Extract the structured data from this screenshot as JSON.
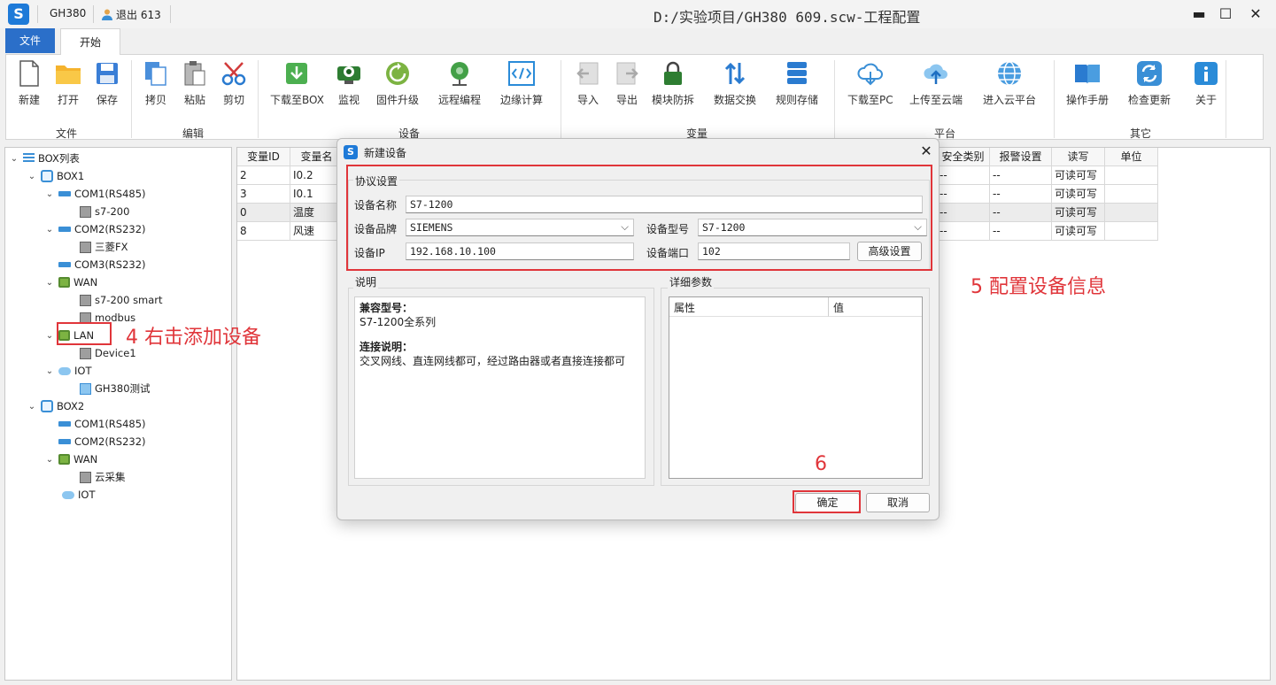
{
  "titlebar": {
    "app_name": "GH380",
    "user_text": "退出 613",
    "window_title": "D:/实验项目/GH380 609.scw-工程配置"
  },
  "tabs": {
    "file": "文件",
    "home": "开始"
  },
  "ribbon": {
    "groups": [
      "文件",
      "编辑",
      "设备",
      "变量",
      "平台",
      "其它"
    ],
    "buttons": [
      "新建",
      "打开",
      "保存",
      "拷贝",
      "粘贴",
      "剪切",
      "下载至BOX",
      "监视",
      "固件升级",
      "远程编程",
      "边缘计算",
      "导入",
      "导出",
      "模块防拆",
      "数据交换",
      "规则存储",
      "下载至PC",
      "上传至云端",
      "进入云平台",
      "操作手册",
      "检查更新",
      "关于"
    ]
  },
  "tree": [
    {
      "label": "BOX列表"
    },
    {
      "label": "BOX1"
    },
    {
      "label": "COM1(RS485)"
    },
    {
      "label": "s7-200"
    },
    {
      "label": "COM2(RS232)"
    },
    {
      "label": "三菱FX"
    },
    {
      "label": "COM3(RS232)"
    },
    {
      "label": "WAN"
    },
    {
      "label": "s7-200 smart"
    },
    {
      "label": "modbus"
    },
    {
      "label": "LAN"
    },
    {
      "label": "Device1"
    },
    {
      "label": "IOT"
    },
    {
      "label": "GH380测试"
    },
    {
      "label": "BOX2"
    },
    {
      "label": "COM1(RS485)"
    },
    {
      "label": "COM2(RS232)"
    },
    {
      "label": "WAN"
    },
    {
      "label": "云采集"
    },
    {
      "label": "IOT"
    }
  ],
  "grid": {
    "left_headers": [
      "变量ID",
      "变量名"
    ],
    "right_headers": [
      "安全类别",
      "报警设置",
      "读写",
      "单位"
    ],
    "rows": [
      {
        "id": "2",
        "name": "I0.2",
        "safety": "--",
        "alarm": "--",
        "rw": "可读可写",
        "unit": ""
      },
      {
        "id": "3",
        "name": "I0.1",
        "safety": "--",
        "alarm": "--",
        "rw": "可读可写",
        "unit": ""
      },
      {
        "id": "0",
        "name": "温度",
        "safety": "--",
        "alarm": "--",
        "rw": "可读可写",
        "unit": ""
      },
      {
        "id": "8",
        "name": "风速",
        "safety": "--",
        "alarm": "--",
        "rw": "可读可写",
        "unit": ""
      }
    ]
  },
  "dialog": {
    "title": "新建设备",
    "protocol_group": "协议设置",
    "device_name_label": "设备名称",
    "device_name": "S7-1200",
    "brand_label": "设备品牌",
    "brand": "SIEMENS",
    "model_label": "设备型号",
    "model": "S7-1200",
    "ip_label": "设备IP",
    "ip": "192.168.10.100",
    "port_label": "设备端口",
    "port": "102",
    "advanced_button": "高级设置",
    "desc_group": "说明",
    "compat_title": "兼容型号：",
    "compat_text": "S7-1200全系列",
    "conn_title": "连接说明：",
    "conn_text": "交叉网线、直连网线都可，经过路由器或者直接连接都可",
    "detail_group": "详细参数",
    "detail_col_attr": "属性",
    "detail_col_value": "值",
    "ok_button": "确定",
    "cancel_button": "取消"
  },
  "annotations": {
    "step4": "4 右击添加设备",
    "step5": "5 配置设备信息",
    "step6": "6"
  },
  "colors": {
    "accent": "#2b6fc9",
    "annotation_red": "#e0353a"
  }
}
